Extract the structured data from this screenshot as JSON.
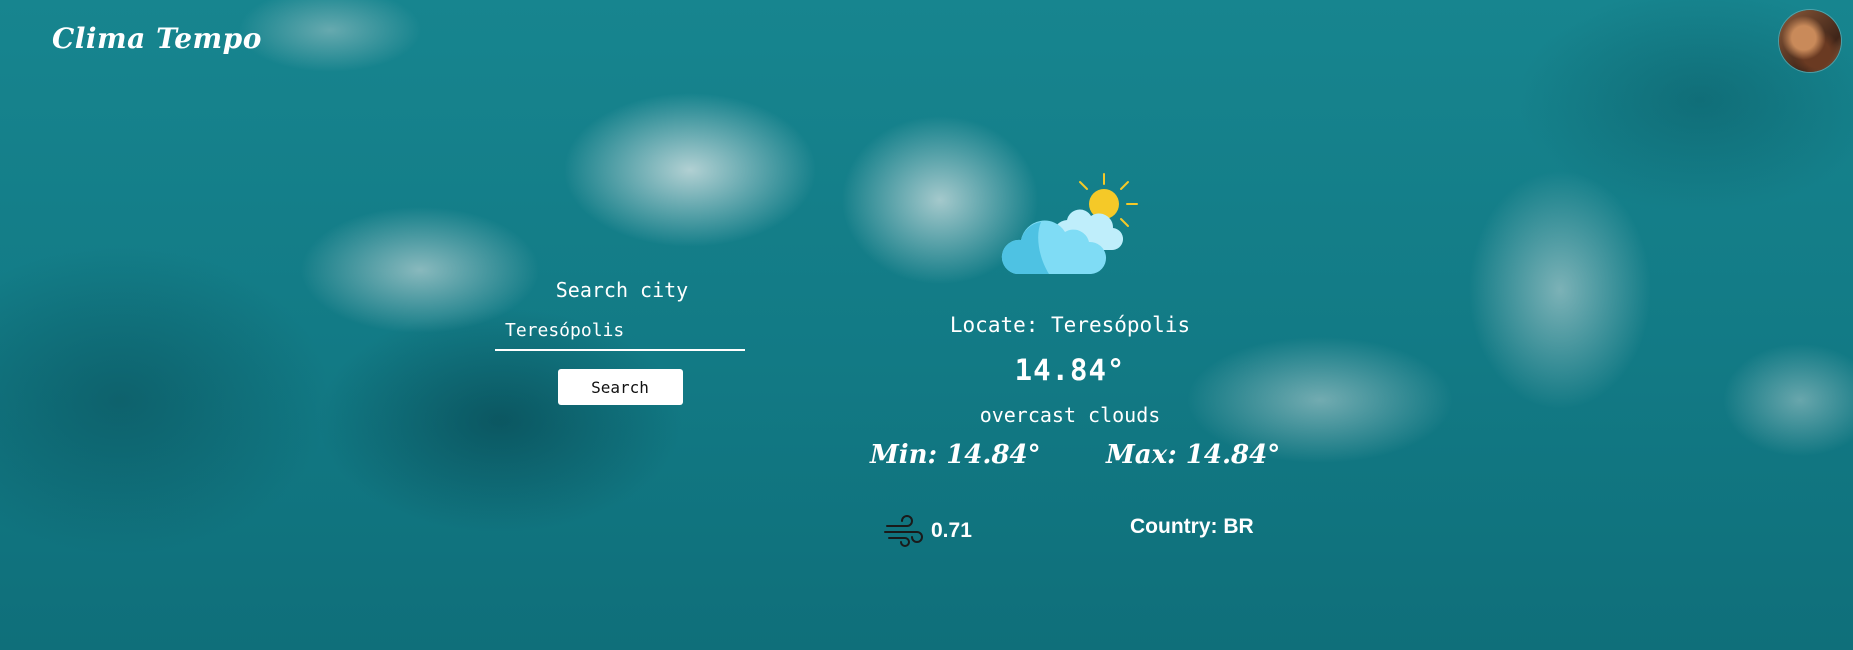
{
  "header": {
    "brand": "Clima Tempo"
  },
  "search": {
    "title": "Search city",
    "value": "Teresópolis",
    "button_label": "Search"
  },
  "weather": {
    "icon": "partly-cloudy-icon",
    "locate": "Locate: Teresópolis",
    "temperature": "14.84°",
    "description": "overcast clouds",
    "min": "Min: 14.84°",
    "max": "Max: 14.84°",
    "wind_icon": "wind-icon",
    "wind": "0.71",
    "country": "Country: BR"
  },
  "colors": {
    "background": "#147f8a",
    "sun": "#f5c928",
    "cloud_light": "#7fdcf5",
    "cloud_dark": "#4ec2e3",
    "text": "#ffffff"
  }
}
